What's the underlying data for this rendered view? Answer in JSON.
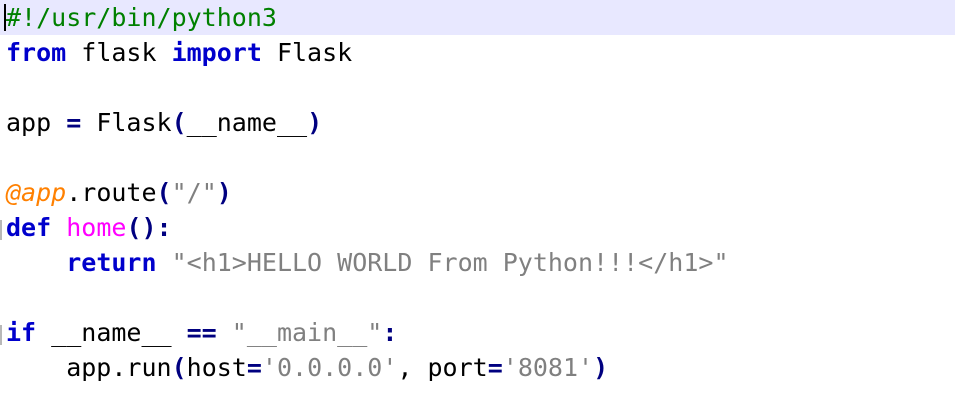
{
  "colors": {
    "keyword": "#0000cc",
    "comment": "#008000",
    "string": "#808080",
    "decorator": "#ff8000",
    "function_name": "#ff00ff",
    "operator": "#000080",
    "default": "#000000",
    "current_line": "#e8e8ff"
  },
  "code": {
    "lines": [
      [
        {
          "t": "#!/usr/bin/python3",
          "k": "comment"
        }
      ],
      [
        {
          "t": "from",
          "k": "keyword"
        },
        {
          "t": " flask ",
          "k": "default"
        },
        {
          "t": "import",
          "k": "keyword"
        },
        {
          "t": " Flask",
          "k": "default"
        }
      ],
      [],
      [
        {
          "t": "app ",
          "k": "default"
        },
        {
          "t": "=",
          "k": "operator"
        },
        {
          "t": " Flask",
          "k": "default"
        },
        {
          "t": "(",
          "k": "operator"
        },
        {
          "t": "__name__",
          "k": "default"
        },
        {
          "t": ")",
          "k": "operator"
        }
      ],
      [],
      [
        {
          "t": "@app",
          "k": "decorator"
        },
        {
          "t": ".route",
          "k": "default"
        },
        {
          "t": "(",
          "k": "operator"
        },
        {
          "t": "\"/\"",
          "k": "string"
        },
        {
          "t": ")",
          "k": "operator"
        }
      ],
      [
        {
          "t": "def",
          "k": "keyword"
        },
        {
          "t": " ",
          "k": "default"
        },
        {
          "t": "home",
          "k": "function_name"
        },
        {
          "t": "():",
          "k": "operator"
        }
      ],
      [
        {
          "t": "    ",
          "k": "default"
        },
        {
          "t": "return",
          "k": "keyword"
        },
        {
          "t": " ",
          "k": "default"
        },
        {
          "t": "\"<h1>HELLO WORLD From Python!!!</h1>\"",
          "k": "string"
        }
      ],
      [],
      [
        {
          "t": "if",
          "k": "keyword"
        },
        {
          "t": " __name__ ",
          "k": "default"
        },
        {
          "t": "==",
          "k": "operator"
        },
        {
          "t": " ",
          "k": "default"
        },
        {
          "t": "\"__main__\"",
          "k": "string"
        },
        {
          "t": ":",
          "k": "operator"
        }
      ],
      [
        {
          "t": "    app.run",
          "k": "default"
        },
        {
          "t": "(",
          "k": "operator"
        },
        {
          "t": "host",
          "k": "default"
        },
        {
          "t": "=",
          "k": "operator"
        },
        {
          "t": "'0.0.0.0'",
          "k": "string"
        },
        {
          "t": ", port",
          "k": "default"
        },
        {
          "t": "=",
          "k": "operator"
        },
        {
          "t": "'8081'",
          "k": "string"
        },
        {
          "t": ")",
          "k": "operator"
        }
      ]
    ]
  }
}
